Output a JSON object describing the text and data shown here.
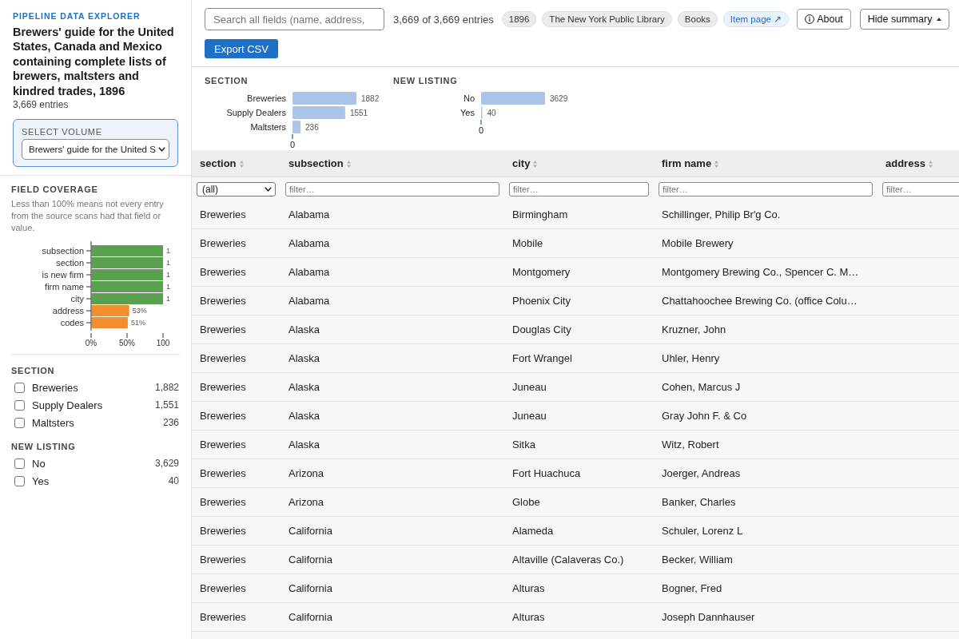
{
  "sidebar": {
    "app_name": "PIPELINE DATA EXPLORER",
    "title": "Brewers' guide for the United States, Canada and Mexico containing complete lists of brewers, maltsters and kindred trades, 1896",
    "entry_count": "3,669 entries",
    "volume_select": {
      "label": "SELECT VOLUME",
      "value": "Brewers' guide for the United S"
    },
    "field_coverage": {
      "heading": "FIELD COVERAGE",
      "note": "Less than 100% means not every entry from the source scans had that field or value.",
      "chart_data": {
        "type": "bar",
        "orientation": "horizontal",
        "categories": [
          "subsection",
          "section",
          "is new firm",
          "firm name",
          "city",
          "address",
          "codes"
        ],
        "values": [
          100,
          100,
          100,
          100,
          100,
          53,
          51
        ],
        "colors": [
          "#59a14f",
          "#59a14f",
          "#59a14f",
          "#59a14f",
          "#59a14f",
          "#f28e2b",
          "#f28e2b"
        ],
        "annotations": [
          "1",
          "1",
          "1",
          "1",
          "1",
          "53%",
          "51%"
        ],
        "xlim": [
          0,
          100
        ],
        "xticks": [
          {
            "value": 0,
            "label": "0%"
          },
          {
            "value": 50,
            "label": "50%"
          },
          {
            "value": 100,
            "label": "100"
          }
        ]
      }
    },
    "filters": [
      {
        "heading": "SECTION",
        "options": [
          {
            "label": "Breweries",
            "count": "1,882",
            "checked": false
          },
          {
            "label": "Supply Dealers",
            "count": "1,551",
            "checked": false
          },
          {
            "label": "Maltsters",
            "count": "236",
            "checked": false
          }
        ]
      },
      {
        "heading": "NEW LISTING",
        "options": [
          {
            "label": "No",
            "count": "3,629",
            "checked": false
          },
          {
            "label": "Yes",
            "count": "40",
            "checked": false
          }
        ]
      }
    ]
  },
  "toolbar": {
    "search": {
      "placeholder": "Search all fields (name, address,"
    },
    "result_count": "3,669 of 3,669 entries",
    "tags": [
      {
        "label": "1896",
        "kind": "tag"
      },
      {
        "label": "The New York Public Library",
        "kind": "tag"
      },
      {
        "label": "Books",
        "kind": "tag"
      },
      {
        "label": "Item page ↗",
        "kind": "link"
      }
    ],
    "buttons": [
      {
        "label": "About",
        "kind": "info"
      },
      {
        "label": "Hide summary",
        "kind": "toggle"
      }
    ],
    "export_button": "Export CSV"
  },
  "summary": {
    "charts": [
      {
        "chart_data": {
          "type": "bar",
          "orientation": "horizontal",
          "title": "SECTION",
          "categories": [
            "Breweries",
            "Supply Dealers",
            "Maltsters"
          ],
          "values": [
            1882,
            1551,
            236
          ],
          "data_labels": true,
          "annotations": [
            "0"
          ]
        }
      },
      {
        "chart_data": {
          "type": "bar",
          "orientation": "horizontal",
          "title": "NEW LISTING",
          "categories": [
            "No",
            "Yes"
          ],
          "values": [
            3629,
            40
          ],
          "data_labels": true,
          "annotations": [
            "0"
          ]
        }
      }
    ]
  },
  "table": {
    "columns": [
      {
        "label": "section",
        "filter": {
          "kind": "select",
          "value": "(all)"
        }
      },
      {
        "label": "subsection",
        "filter": {
          "kind": "text",
          "placeholder": "filter…"
        }
      },
      {
        "label": "city",
        "filter": {
          "kind": "text",
          "placeholder": "filter…"
        }
      },
      {
        "label": "firm name",
        "filter": {
          "kind": "text",
          "placeholder": "filter…"
        }
      },
      {
        "label": "address",
        "filter": {
          "kind": "text",
          "placeholder": "filter…"
        }
      }
    ],
    "rows": [
      [
        "Breweries",
        "Alabama",
        "Birmingham",
        "Schillinger, Philip Br'g Co."
      ],
      [
        "Breweries",
        "Alabama",
        "Mobile",
        "Mobile Brewery"
      ],
      [
        "Breweries",
        "Alabama",
        "Montgomery",
        "Montgomery Brewing Co., Spencer C. M…"
      ],
      [
        "Breweries",
        "Alabama",
        "Phoenix City",
        "Chattahoochee Brewing Co. (office Colu…"
      ],
      [
        "Breweries",
        "Alaska",
        "Douglas City",
        "Kruzner, John"
      ],
      [
        "Breweries",
        "Alaska",
        "Fort Wrangel",
        "Uhler, Henry"
      ],
      [
        "Breweries",
        "Alaska",
        "Juneau",
        "Cohen, Marcus J"
      ],
      [
        "Breweries",
        "Alaska",
        "Juneau",
        "Gray John F. & Co"
      ],
      [
        "Breweries",
        "Alaska",
        "Sitka",
        "Witz, Robert"
      ],
      [
        "Breweries",
        "Arizona",
        "Fort Huachuca",
        "Joerger, Andreas"
      ],
      [
        "Breweries",
        "Arizona",
        "Globe",
        "Banker, Charles"
      ],
      [
        "Breweries",
        "California",
        "Alameda",
        "Schuler, Lorenz L"
      ],
      [
        "Breweries",
        "California",
        "Altaville (Calaveras Co.)",
        "Becker, William"
      ],
      [
        "Breweries",
        "California",
        "Alturas",
        "Bogner, Fred"
      ],
      [
        "Breweries",
        "California",
        "Alturas",
        "Joseph Dannhauser"
      ]
    ]
  }
}
